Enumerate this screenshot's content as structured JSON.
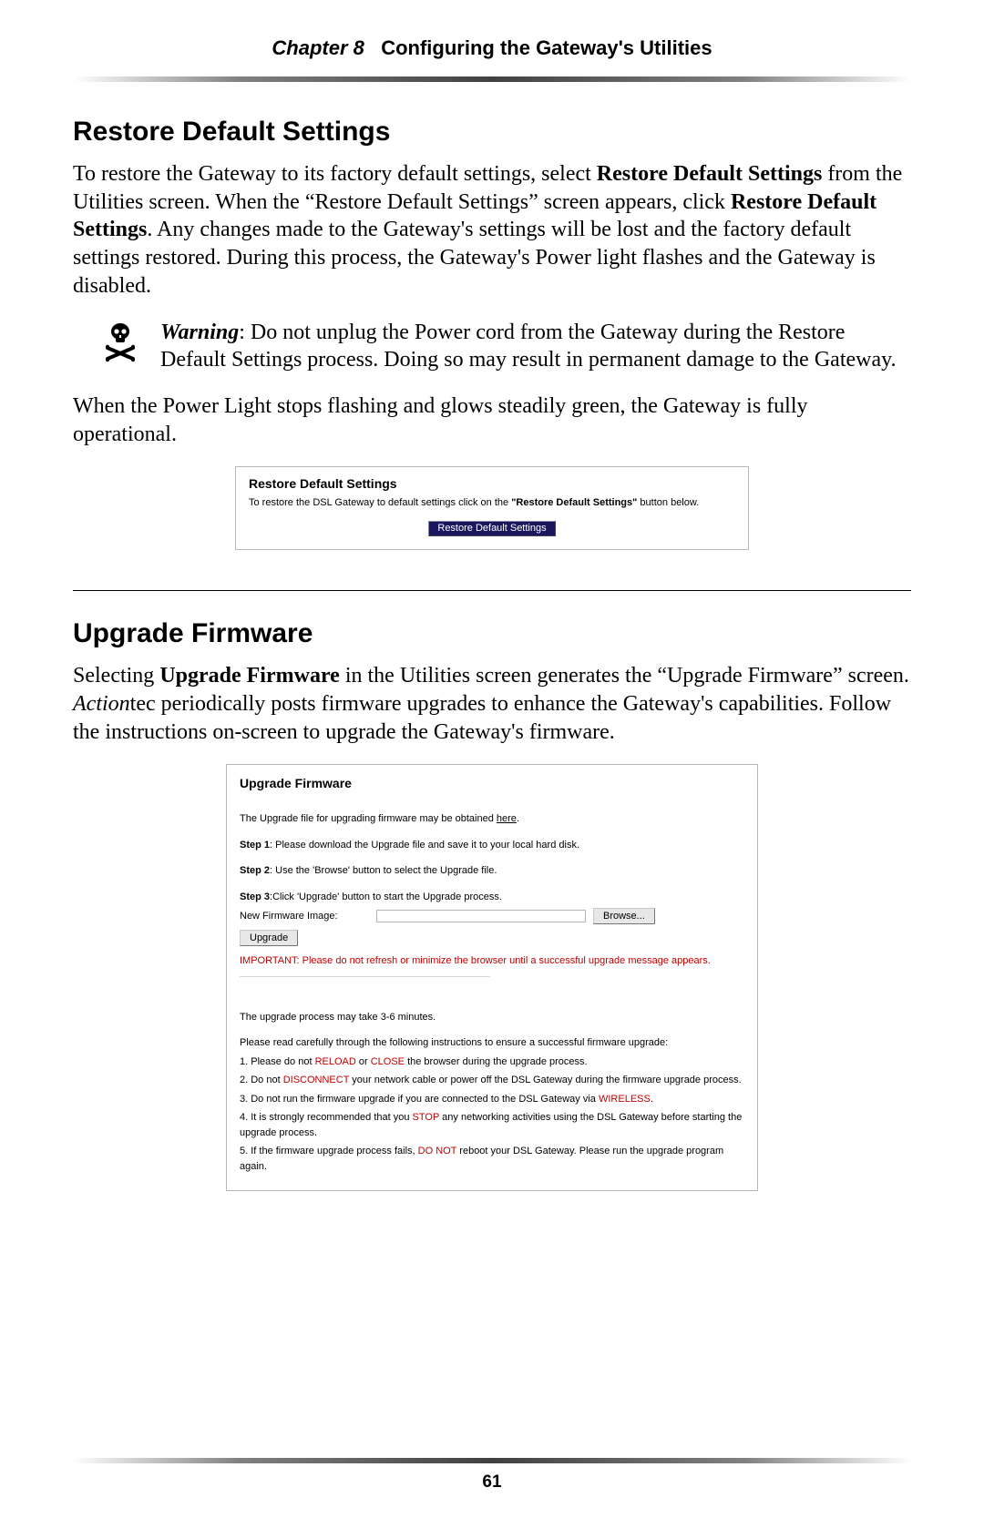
{
  "header": {
    "chapter_label": "Chapter 8",
    "chapter_title": "Configuring the Gateway's Utilities"
  },
  "section1": {
    "heading": "Restore Default Settings",
    "p1_a": "To restore the Gateway to its factory default settings, select ",
    "p1_b": "Restore Default Settings",
    "p1_c": " from the Utilities screen. When the “Restore Default Settings” screen appears, click ",
    "p1_d": "Restore Default Settings",
    "p1_e": ". Any changes made to the Gateway's settings will be lost and the factory default settings restored. During this process, the Gateway's Power light flashes and the Gateway is disabled.",
    "warning_label": "Warning",
    "warning_text": ": Do not unplug the Power cord from the Gateway during the Restore Default Settings process. Doing so may result in permanent damage to the Gateway.",
    "p2": "When the Power Light stops flashing and glows steadily green, the Gateway is fully operational."
  },
  "panel1": {
    "title": "Restore Default Settings",
    "desc_a": "To restore the DSL Gateway to default settings click on the ",
    "desc_b": "\"Restore Default Settings\"",
    "desc_c": " button below.",
    "button": "Restore Default Settings"
  },
  "section2": {
    "heading": "Upgrade Firmware",
    "p1_a": "Selecting ",
    "p1_b": "Upgrade Firmware",
    "p1_c": " in the Utilities screen generates the “Upgrade Firmware” screen. ",
    "p1_d": "Action",
    "p1_e": "tec periodically posts firmware upgrades to enhance the Gateway's capabilities. Follow the instructions on-screen to upgrade the Gateway's firmware."
  },
  "panel2": {
    "title": "Upgrade Firmware",
    "l_intro_a": "The Upgrade file for upgrading firmware may be obtained ",
    "l_intro_link": "here",
    "l_intro_b": ".",
    "step1_lbl": "Step 1",
    "step1_txt": ": Please download the Upgrade file and save it to your local hard disk.",
    "step2_lbl": "Step 2",
    "step2_txt": ": Use the 'Browse' button to select the Upgrade file.",
    "step3_lbl": "Step 3",
    "step3_txt": ":Click 'Upgrade' button to start the Upgrade process.",
    "img_label": "New Firmware Image:",
    "browse_btn": "Browse...",
    "upgrade_btn": "Upgrade",
    "important": "IMPORTANT: Please do not refresh or minimize the browser until a successful upgrade message appears.",
    "duration": "The upgrade process may take 3-6 minutes.",
    "instr_intro": "Please read carefully through the following instructions to ensure a successful firmware upgrade:",
    "n1_a": "1. Please do not ",
    "n1_b": "RELOAD",
    "n1_c": " or ",
    "n1_d": "CLOSE",
    "n1_e": " the browser during the upgrade process.",
    "n2_a": "2. Do not ",
    "n2_b": "DISCONNECT",
    "n2_c": " your network cable or power off the DSL Gateway during the firmware upgrade process.",
    "n3_a": "3. Do not run the firmware upgrade if you are connected to the DSL Gateway via ",
    "n3_b": "WIRELESS",
    "n3_c": ".",
    "n4_a": "4. It is strongly recommended that you ",
    "n4_b": "STOP",
    "n4_c": " any networking activities using the DSL Gateway before starting the upgrade process.",
    "n5_a": "5. If the firmware upgrade process fails, ",
    "n5_b": "DO NOT",
    "n5_c": " reboot your DSL Gateway. Please run the upgrade program again."
  },
  "page_number": "61"
}
